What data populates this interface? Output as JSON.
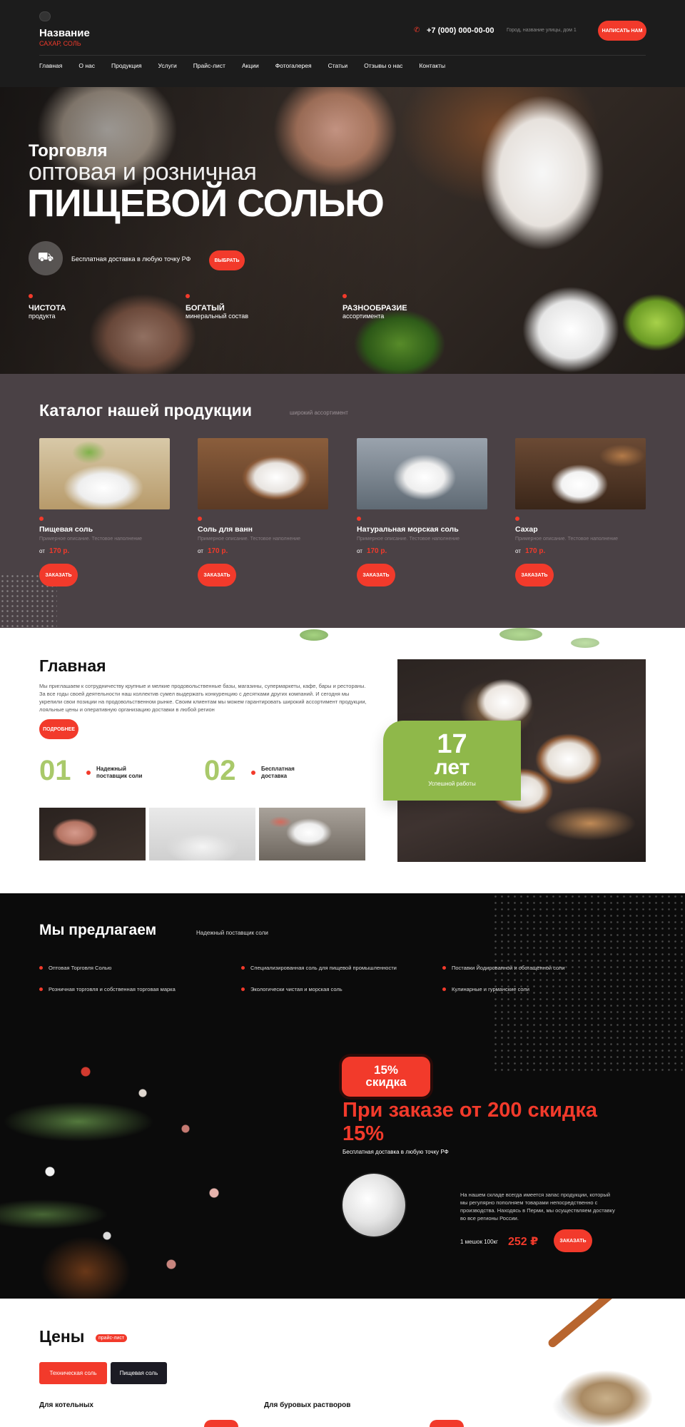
{
  "header": {
    "logo_title": "Название",
    "logo_sub": "САХАР, СОЛЬ",
    "phone": "+7 (000) 000-00-00",
    "address": "Город, название улицы, дом 1",
    "write_btn": "НАПИСАТЬ НАМ",
    "nav": [
      "Главная",
      "О нас",
      "Продукция",
      "Услуги",
      "Прайс-лист",
      "Акции",
      "Фотогалерея",
      "Статьи",
      "Отзывы о нас",
      "Контакты"
    ]
  },
  "hero": {
    "line1": "Торговля",
    "line2": "оптовая и розничная",
    "line3": "ПИЩЕВОЙ СОЛЬЮ",
    "delivery": "Бесплатная доставка в любую точку РФ",
    "choose_btn": "ВЫБРАТЬ",
    "features": [
      {
        "title": "ЧИСТОТА",
        "sub": "продукта"
      },
      {
        "title": "БОГАТЫЙ",
        "sub": "минеральный состав"
      },
      {
        "title": "РАЗНООБРАЗИЕ",
        "sub": "ассортимента"
      }
    ]
  },
  "catalog": {
    "title": "Каталог нашей продукции",
    "sub": "широкий ассортимент",
    "items": [
      {
        "name": "Пищевая соль",
        "desc": "Примерное описание. Тестовое наполнение",
        "from": "от",
        "price": "170 р.",
        "btn": "ЗАКАЗАТЬ"
      },
      {
        "name": "Соль для ванн",
        "desc": "Примерное описание. Тестовое наполнение",
        "from": "от",
        "price": "170 р.",
        "btn": "ЗАКАЗАТЬ"
      },
      {
        "name": "Натуральная морская соль",
        "desc": "Примерное описание. Тестовое наполнение",
        "from": "от",
        "price": "170 р.",
        "btn": "ЗАКАЗАТЬ"
      },
      {
        "name": "Сахар",
        "desc": "Примерное описание. Тестовое наполнение",
        "from": "от",
        "price": "170 р.",
        "btn": "ЗАКАЗАТЬ"
      }
    ]
  },
  "about": {
    "title": "Главная",
    "text": "Мы приглашаем к сотрудничеству крупные и мелкие продовольственные базы, магазины, супермаркеты, кафе, бары и рестораны. За все годы своей деятельности наш коллектив сумел выдержать конкуренцию с десятками других компаний. И сегодня мы укрепили свои позиции на продовольственном рынке. Своим клиентам мы можем гарантировать широкий ассортимент продукции, лояльные цены и оперативную организацию доставки в любой регион",
    "more_btn": "ПОДРОБНЕЕ",
    "points": [
      {
        "num": "01",
        "label": "Надежный поставщик соли"
      },
      {
        "num": "02",
        "label": "Бесплатная доставка"
      }
    ],
    "years_num": "17",
    "years_word": "лет",
    "years_sub": "Успешной работы"
  },
  "offer": {
    "title": "Мы предлагаем",
    "sub": "Надежный поставщик соли",
    "items": [
      "Оптовая Торговля Солью",
      "Специализированная соль для пищевой промышленности",
      "Поставки Йодированной и обогащённой соли",
      "Розничная торговля и собственная торговая марка",
      "Экологически чистая и морская соль",
      "Кулинарные и гурманские соли"
    ],
    "badge_line1": "15%",
    "badge_line2": "скидка",
    "big": "При заказе от 200 скидка 15%",
    "delivery": "Бесплатная доставка в любую точку РФ",
    "text": "На нашем складе всегда имеется запас продукции, который мы регулярно пополняем товарами непосредственно с производства. Находясь в Перми, мы осуществляем доставку во все регионы России.",
    "bag": "1 мешок 100кг",
    "price": "252 ₽",
    "btn": "ЗАКАЗАТЬ"
  },
  "prices": {
    "title": "Цены",
    "badge": "прайс-лист",
    "tabs": [
      "Техническая соль",
      "Пищевая соль"
    ],
    "col1": "Для котельных",
    "col2": "Для буровых растворов"
  },
  "colors": {
    "accent": "#f23a2b",
    "green": "#8fb84a",
    "dark": "#1c1c1c",
    "catalog_bg": "#4a4145"
  }
}
